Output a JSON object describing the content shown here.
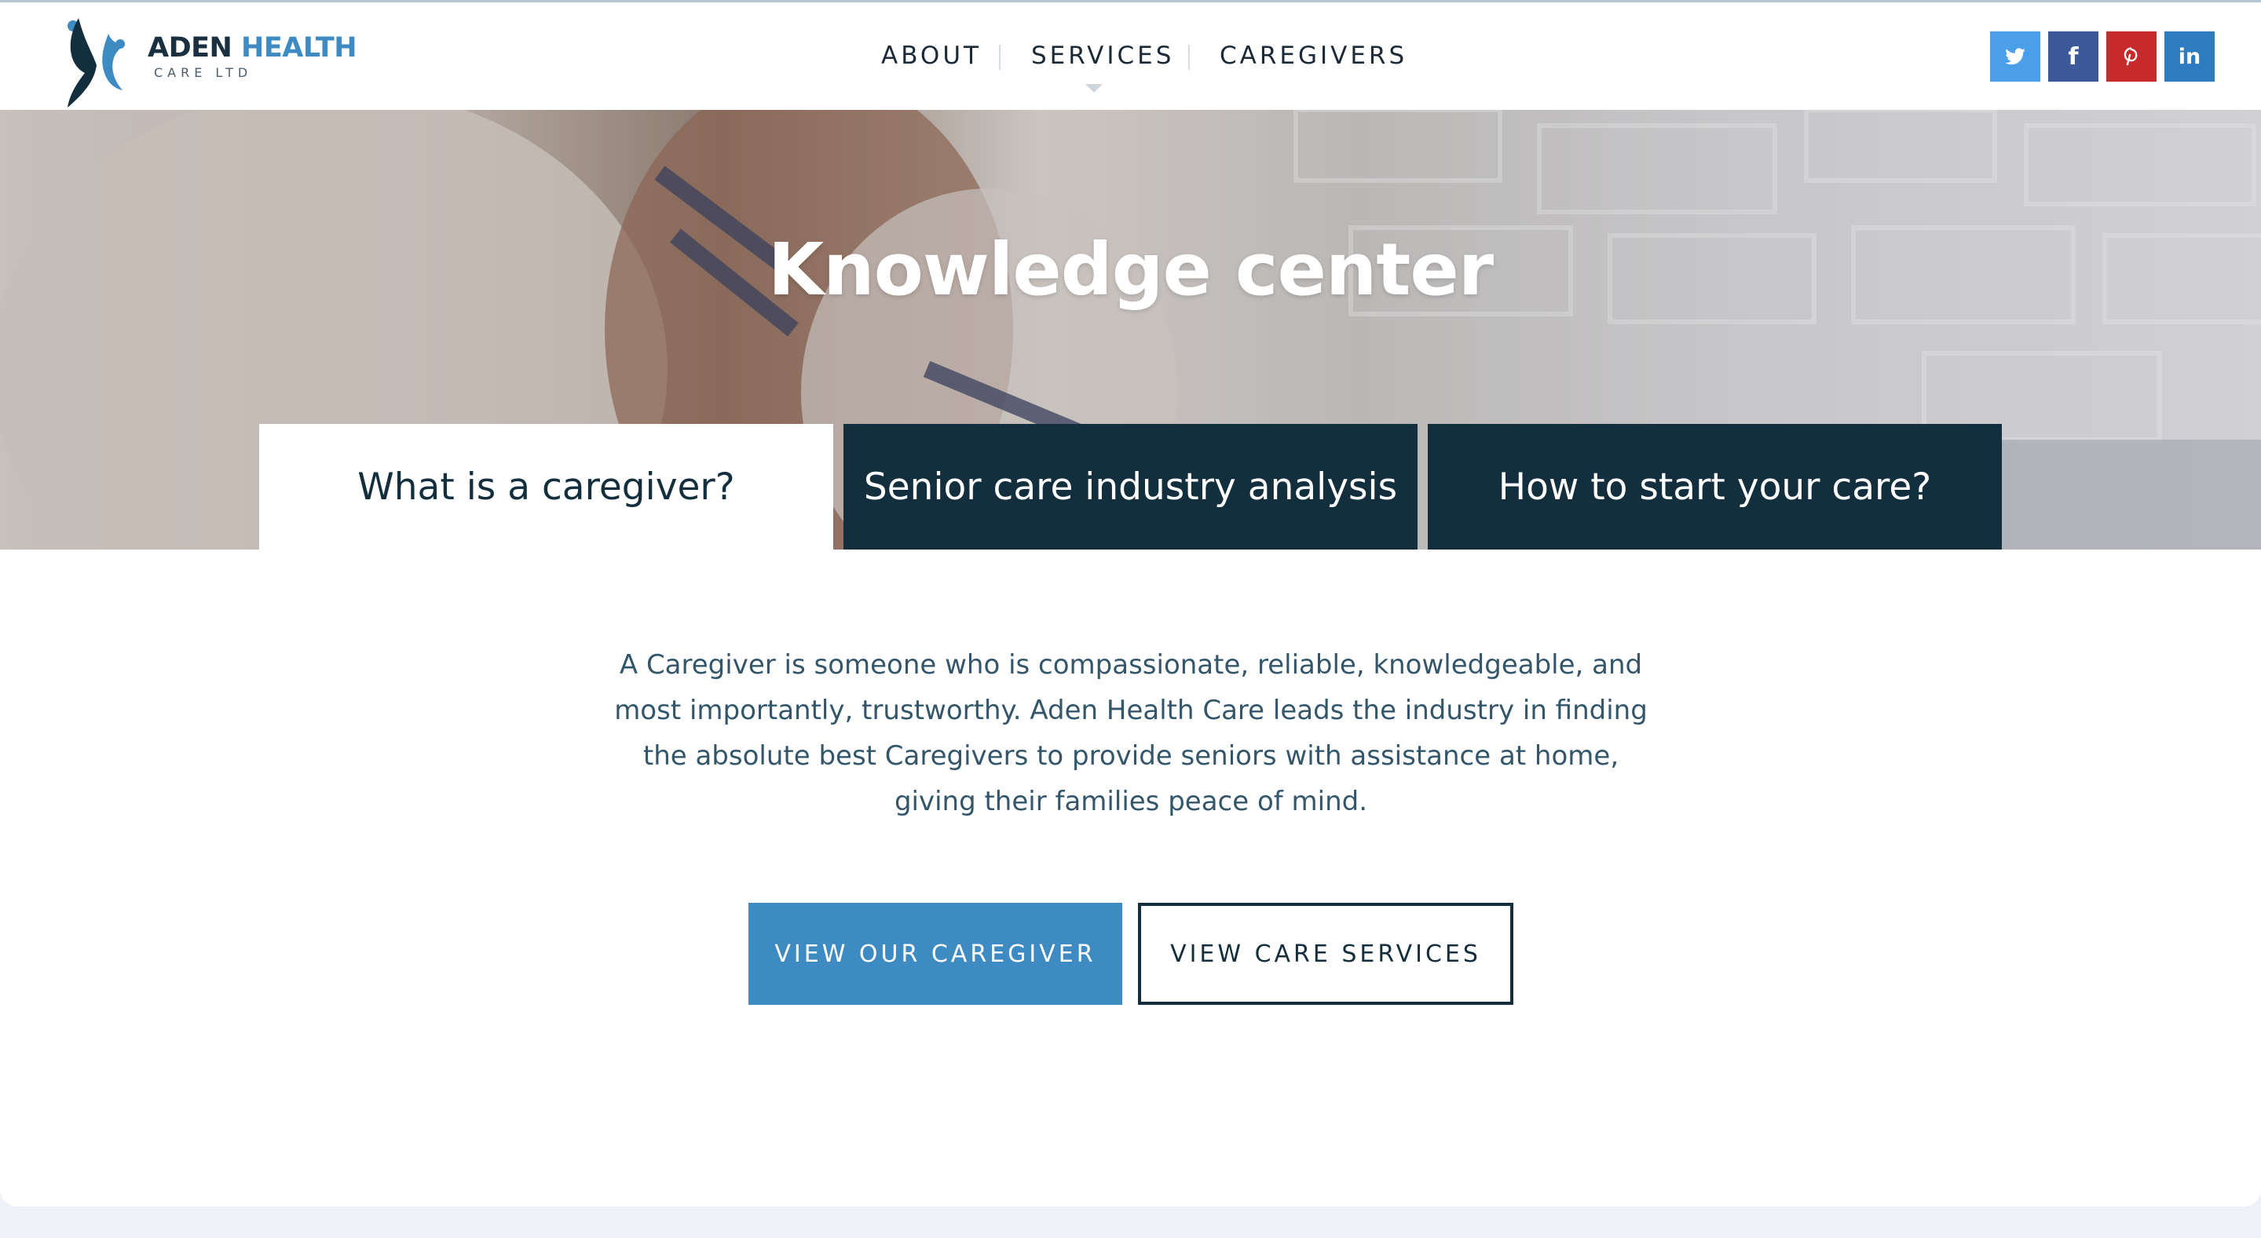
{
  "brand": {
    "name_part1": "ADEN",
    "name_part2": "HEALTH",
    "sub": "CARE LTD",
    "primary_color": "#132e3d",
    "accent_color": "#3d8bc2"
  },
  "nav": {
    "items": [
      {
        "label": "ABOUT"
      },
      {
        "label": "SERVICES"
      },
      {
        "label": "CAREGIVERS"
      }
    ]
  },
  "social": [
    {
      "name": "twitter-icon",
      "color": "#4a9fe8"
    },
    {
      "name": "facebook-icon",
      "color": "#3c5a99",
      "glyph": "f"
    },
    {
      "name": "pinterest-icon",
      "color": "#c62a2a"
    },
    {
      "name": "linkedin-icon",
      "color": "#2f7bbf",
      "glyph": "in"
    }
  ],
  "hero": {
    "title": "Knowledge center"
  },
  "tabs": [
    {
      "label": "What is a caregiver?",
      "active": true
    },
    {
      "label": "Senior care industry analysis",
      "active": false
    },
    {
      "label": "How to start your care?",
      "active": false
    }
  ],
  "content": {
    "paragraph": "A Caregiver is someone who is compassionate, reliable, knowledgeable, and most importantly, trustworthy. Aden Health Care leads the industry in finding the absolute best Caregivers to provide seniors with assistance at home, giving their families peace of mind.",
    "primary_button": "VIEW OUR CAREGIVER",
    "secondary_button": "VIEW CARE SERVICES"
  }
}
